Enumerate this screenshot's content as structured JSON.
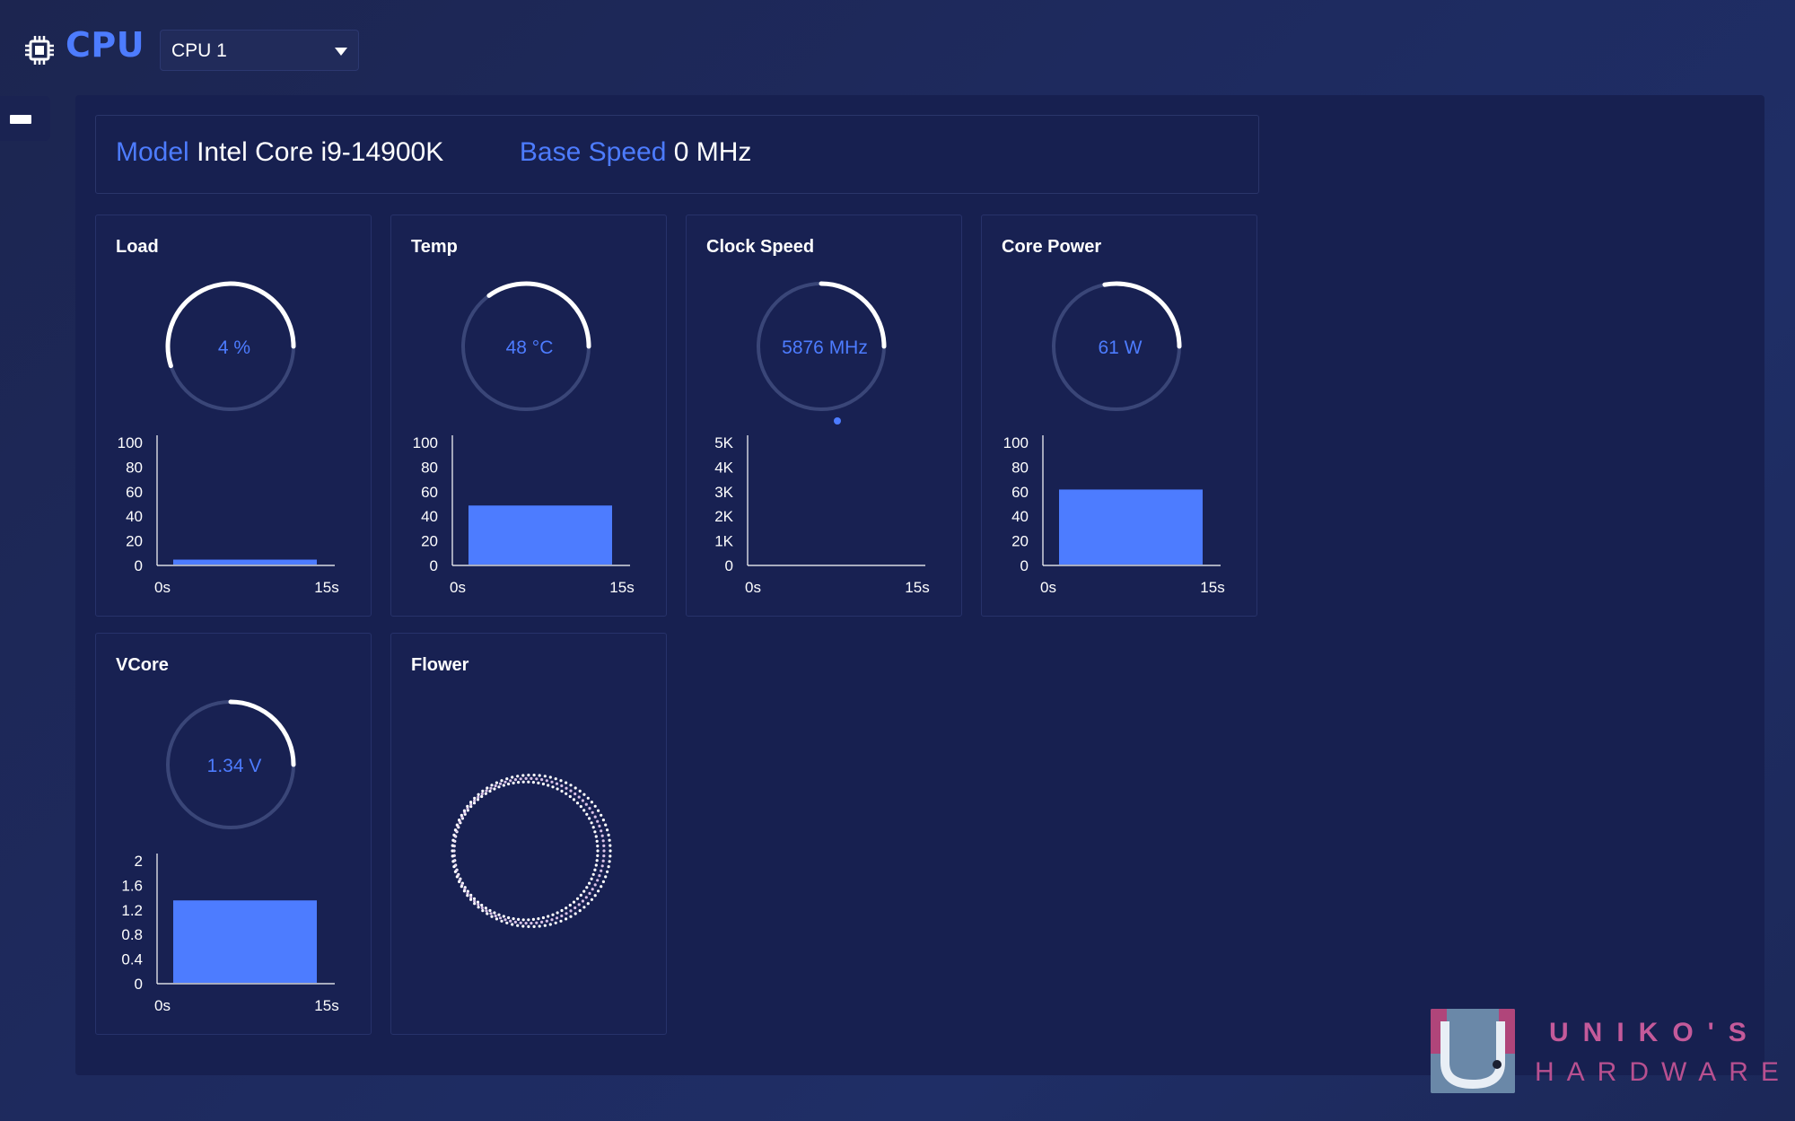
{
  "app": {
    "title": "CPU",
    "icon": "cpu-chip-icon",
    "cpu_selector": {
      "selected": "CPU 1"
    }
  },
  "info": {
    "model_label": "Model",
    "model_value": "Intel Core i9-14900K",
    "base_speed_label": "Base Speed",
    "base_speed_value": "0 MHz"
  },
  "colors": {
    "accent": "#4d7cff",
    "background": "#1c2550",
    "panel": "#172050",
    "gauge_track": "#3a4678",
    "gauge_fill": "#ffffff"
  },
  "cards": [
    {
      "id": "load",
      "title": "Load",
      "gauge_text": "4 %",
      "gauge_fraction": 0.55,
      "y_ticks": [
        "100",
        "80",
        "60",
        "40",
        "20",
        "0"
      ],
      "y_max": 100,
      "x_ticks": [
        "0s",
        "15s"
      ],
      "chart_kind": "bar",
      "value": 4
    },
    {
      "id": "temp",
      "title": "Temp",
      "gauge_text": "48 °C",
      "gauge_fraction": 0.35,
      "y_ticks": [
        "100",
        "80",
        "60",
        "40",
        "20",
        "0"
      ],
      "y_max": 100,
      "x_ticks": [
        "0s",
        "15s"
      ],
      "chart_kind": "bar",
      "value": 48
    },
    {
      "id": "clock",
      "title": "Clock Speed",
      "gauge_text": "5876 MHz",
      "gauge_fraction": 0.25,
      "y_ticks": [
        "5K",
        "4K",
        "3K",
        "2K",
        "1K",
        "0"
      ],
      "y_max": 5000,
      "x_ticks": [
        "0s",
        "15s"
      ],
      "chart_kind": "point",
      "value": 5876
    },
    {
      "id": "power",
      "title": "Core Power",
      "gauge_text": "61 W",
      "gauge_fraction": 0.28,
      "y_ticks": [
        "100",
        "80",
        "60",
        "40",
        "20",
        "0"
      ],
      "y_max": 100,
      "x_ticks": [
        "0s",
        "15s"
      ],
      "chart_kind": "bar",
      "value": 61
    },
    {
      "id": "vcore",
      "title": "VCore",
      "gauge_text": "1.34 V",
      "gauge_fraction": 0.25,
      "y_ticks": [
        "2",
        "1.6",
        "1.2",
        "0.8",
        "0.4",
        "0"
      ],
      "y_max": 2,
      "x_ticks": [
        "0s",
        "15s"
      ],
      "chart_kind": "bar",
      "value": 1.34
    },
    {
      "id": "flower",
      "title": "Flower",
      "chart_kind": "flower"
    }
  ],
  "watermark": {
    "line1": "UNIKO'S",
    "line2": "HARDWARE"
  }
}
